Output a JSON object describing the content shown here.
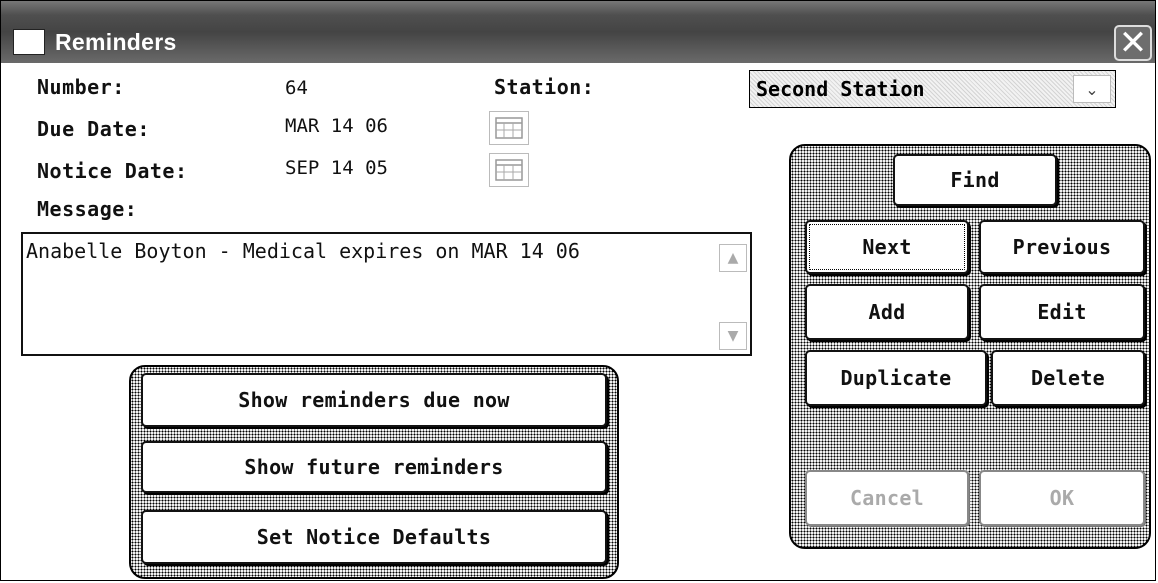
{
  "window": {
    "title": "Reminders",
    "close_glyph": "✕"
  },
  "fields": {
    "number_label": "Number:",
    "number_value": "64",
    "station_label": "Station:",
    "station_value": "Second Station",
    "due_date_label": "Due Date:",
    "due_date_value": "MAR 14 06",
    "notice_date_label": "Notice Date:",
    "notice_date_value": "SEP 14 05",
    "message_label": "Message:"
  },
  "message": {
    "text": "Anabelle Boyton - Medical expires on MAR 14 06"
  },
  "scroll": {
    "up_glyph": "▲",
    "down_glyph": "▼"
  },
  "dropdown_glyph": "⌄",
  "show_buttons": [
    "Show reminders due now",
    "Show future reminders",
    "Set Notice Defaults"
  ],
  "nav": {
    "find": "Find",
    "next": "Next",
    "previous": "Previous",
    "add": "Add",
    "edit": "Edit",
    "duplicate": "Duplicate",
    "delete": "Delete",
    "cancel": "Cancel",
    "ok": "OK"
  },
  "icons": {
    "calendar": "calendar-icon",
    "close": "close-icon",
    "dropdown": "chevron-down-icon"
  }
}
